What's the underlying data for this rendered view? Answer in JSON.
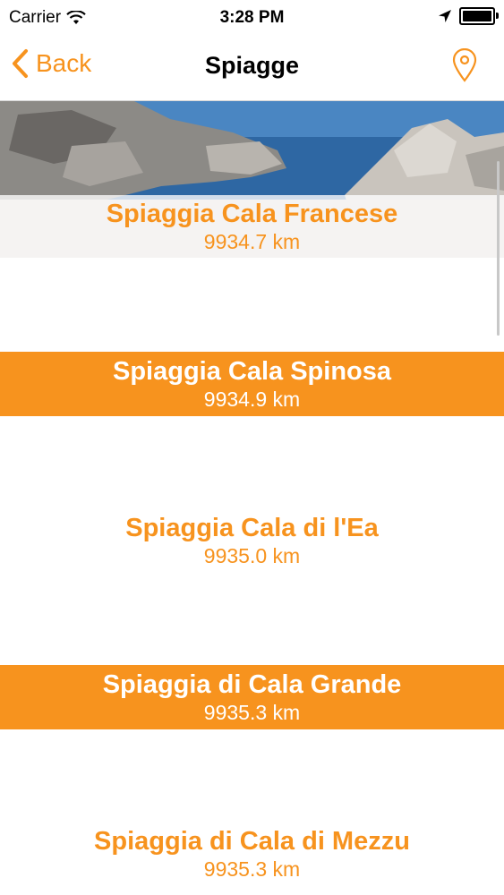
{
  "status_bar": {
    "carrier": "Carrier",
    "time": "3:28 PM"
  },
  "nav": {
    "back_label": "Back",
    "title": "Spiagge"
  },
  "colors": {
    "accent": "#f7931e",
    "white": "#ffffff"
  },
  "beaches": [
    {
      "name": "Spiaggia Cala Francese",
      "distance": "9934.7 km",
      "style": "photo"
    },
    {
      "name": "Spiaggia Cala Spinosa",
      "distance": "9934.9 km",
      "style": "orange"
    },
    {
      "name": "Spiaggia Cala di l'Ea",
      "distance": "9935.0 km",
      "style": "white"
    },
    {
      "name": "Spiaggia di Cala Grande",
      "distance": "9935.3 km",
      "style": "orange"
    },
    {
      "name": "Spiaggia di Cala di Mezzu",
      "distance": "9935.3 km",
      "style": "white"
    }
  ]
}
